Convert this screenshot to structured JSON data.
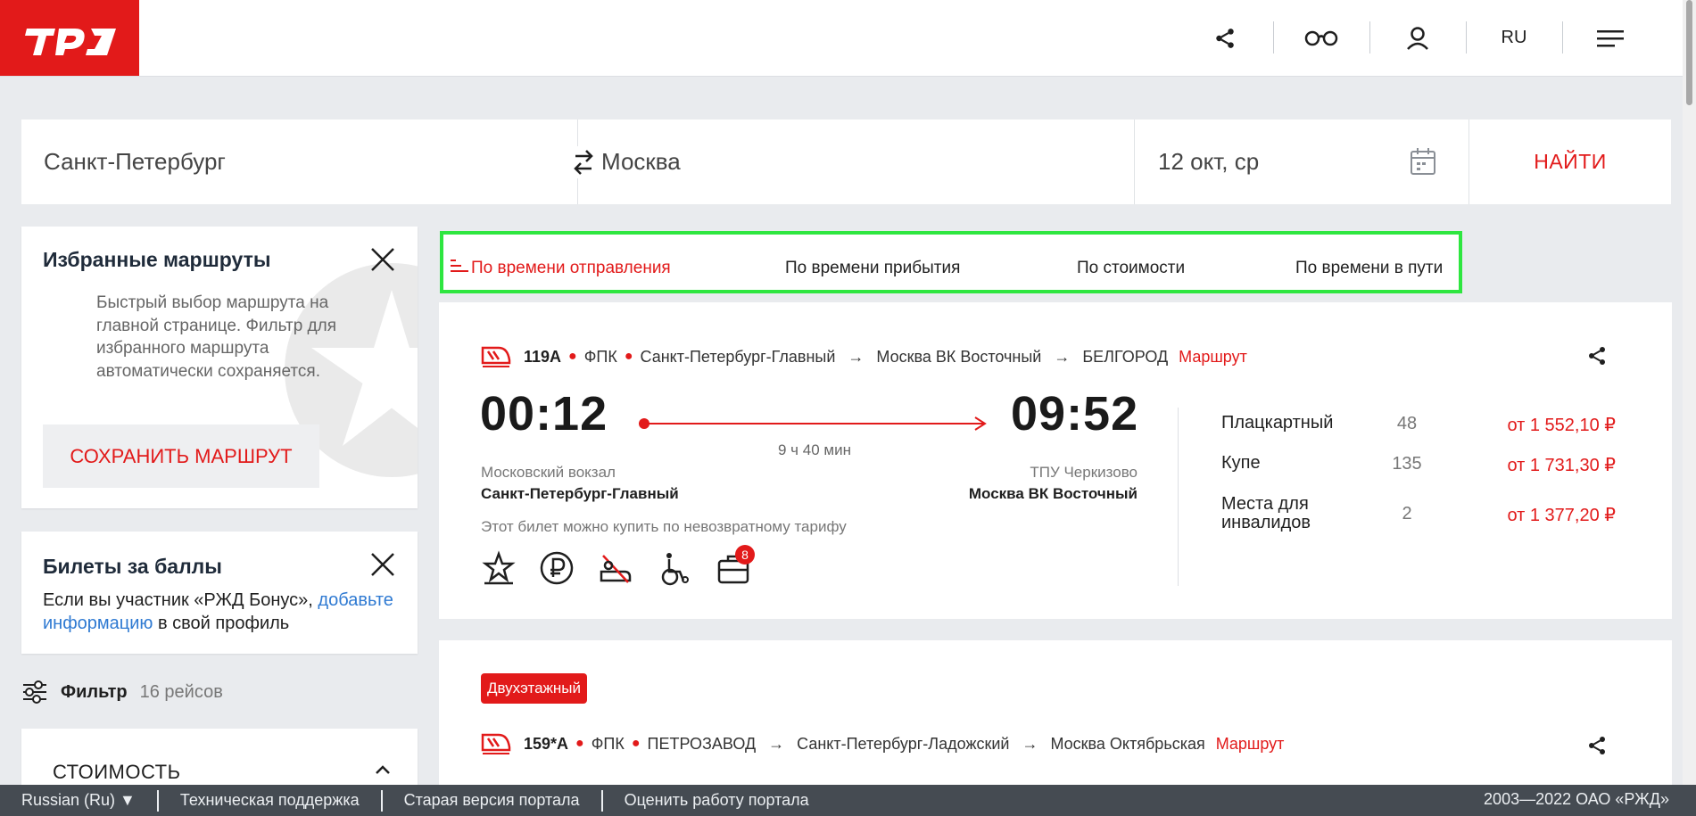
{
  "header": {
    "logo_alt": "РЖД",
    "lang": "RU"
  },
  "search": {
    "from": "Санкт-Петербург",
    "to": "Москва",
    "date": "12 окт, ср",
    "find_label": "НАЙТИ"
  },
  "sidebar": {
    "favorites": {
      "title": "Избранные маршруты",
      "text": "Быстрый выбор маршрута на главной странице. Фильтр для избранного маршрута автоматически сохраняется.",
      "save_label": "СОХРАНИТЬ МАРШРУТ"
    },
    "bonus": {
      "title": "Билеты за баллы",
      "text_before": "Если вы участник «РЖД Бонус», ",
      "link": "добавьте информацию",
      "text_after": " в свой профиль"
    },
    "filter": {
      "label": "Фильтр",
      "count": "16 рейсов"
    },
    "cost": {
      "title": "СТОИМОСТЬ"
    }
  },
  "sort": {
    "items": [
      {
        "label": "По времени отправления",
        "active": true
      },
      {
        "label": "По времени прибытия",
        "active": false
      },
      {
        "label": "По стоимости",
        "active": false
      },
      {
        "label": "По времени в пути",
        "active": false
      }
    ]
  },
  "trains": [
    {
      "number": "119А",
      "carrier": "ФПК",
      "from_station": "Санкт-Петербург-Главный",
      "via_station": "Москва ВК Восточный",
      "to_station": "БЕЛГОРОД",
      "route_link": "Маршрут",
      "depart_time": "00:12",
      "arrive_time": "09:52",
      "duration": "9 ч 40 мин",
      "depart_station_small": "Московский вокзал",
      "depart_station": "Санкт-Петербург-Главный",
      "arrive_station_small": "ТПУ Черкизово",
      "arrive_station": "Москва ВК Восточный",
      "note": "Этот билет можно купить по невозвратному тарифу",
      "services_badge": "8",
      "seats": [
        {
          "type": "Плацкартный",
          "count": "48",
          "price": "от 1 552,10 ₽"
        },
        {
          "type": "Купе",
          "count": "135",
          "price": "от 1 731,30 ₽"
        },
        {
          "type": "Места для инвалидов",
          "count": "2",
          "price": "от 1 377,20 ₽"
        }
      ]
    },
    {
      "badge": "Двухэтажный",
      "number": "159*А",
      "carrier": "ФПК",
      "from_station": "ПЕТРОЗАВОД",
      "via_station": "Санкт-Петербург-Ладожский",
      "to_station": "Москва Октябрьская",
      "route_link": "Маршрут"
    }
  ],
  "footer": {
    "language": "Russian (Ru)",
    "support": "Техническая поддержка",
    "old_version": "Старая версия портала",
    "rate": "Оценить работу портала",
    "copyright": "2003—2022 ОАО «РЖД»"
  },
  "colors": {
    "brand": "#e21a1a",
    "highlight": "#2ee640",
    "link": "#2f7ad2"
  }
}
